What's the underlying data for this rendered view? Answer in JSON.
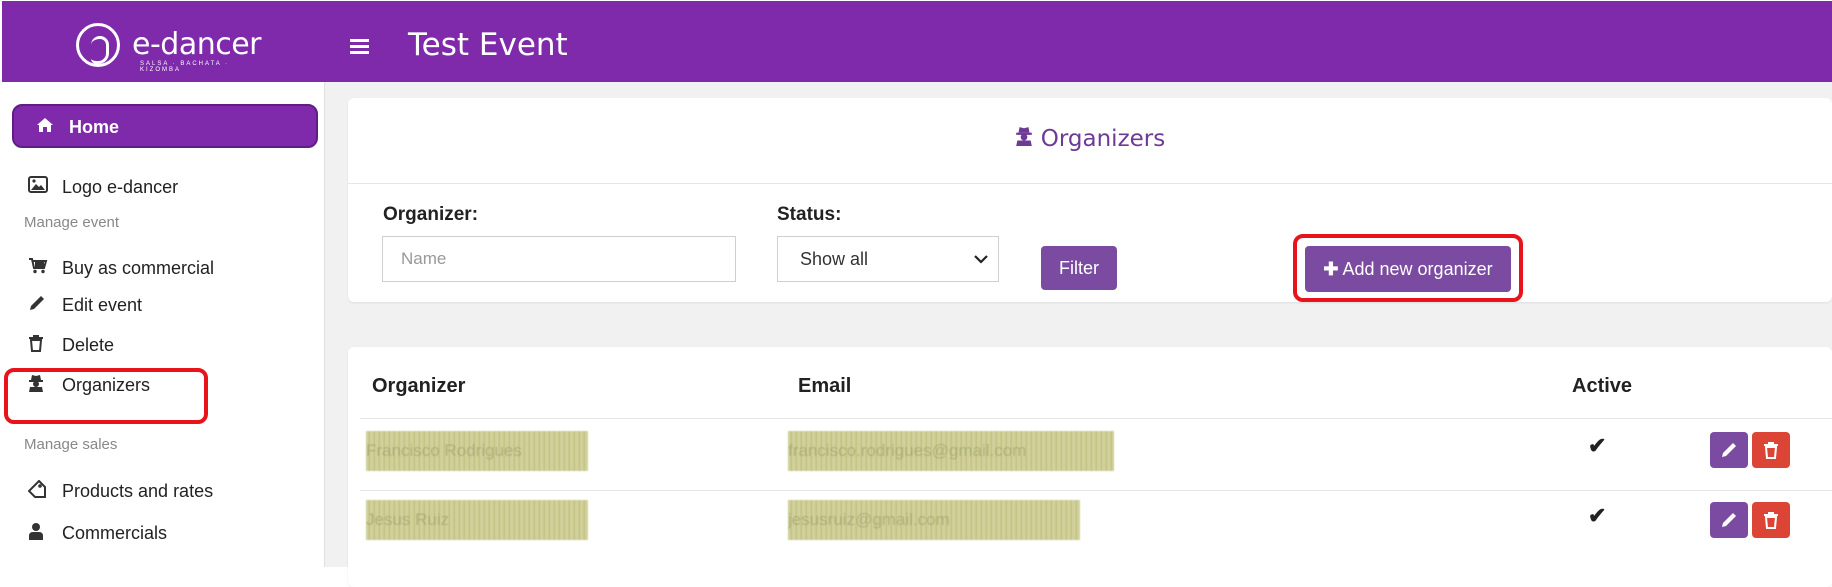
{
  "header": {
    "logo_text": "e-dancer",
    "logo_tagline": "SALSA · BACHATA · KIZOMBA",
    "title": "Test Event"
  },
  "sidebar": {
    "home": "Home",
    "logo_item": "Logo e-dancer",
    "section_manage_event": "Manage event",
    "buy_as_commercial": "Buy as commercial",
    "edit_event": "Edit event",
    "delete": "Delete",
    "organizers": "Organizers",
    "section_manage_sales": "Manage sales",
    "products_and_rates": "Products and rates",
    "commercials": "Commercials"
  },
  "panel": {
    "title": "Organizers",
    "organizer_label": "Organizer:",
    "organizer_placeholder": "Name",
    "status_label": "Status:",
    "status_selected": "Show all",
    "filter_button": "Filter",
    "add_button": "Add new organizer"
  },
  "table": {
    "columns": [
      "Organizer",
      "Email",
      "Active"
    ],
    "rows": [
      {
        "organizer": "Francisco Rodrigues",
        "email": "francisco.rodrigues@gmail.com",
        "active": "✔"
      },
      {
        "organizer": "Jesus Ruiz",
        "email": "jesusruiz@gmail.com",
        "active": "✔"
      }
    ]
  },
  "colors": {
    "brand_purple": "#7e2aaa",
    "button_purple": "#7a4ba0",
    "delete_red": "#dc4535",
    "highlight_red": "#e8131b"
  },
  "icons": {
    "home": "home-icon",
    "image": "image-icon",
    "cart": "cart-icon",
    "pencil": "pencil-icon",
    "trash": "trash-icon",
    "spy": "user-secret-icon",
    "tag": "tag-icon",
    "user": "user-icon"
  }
}
